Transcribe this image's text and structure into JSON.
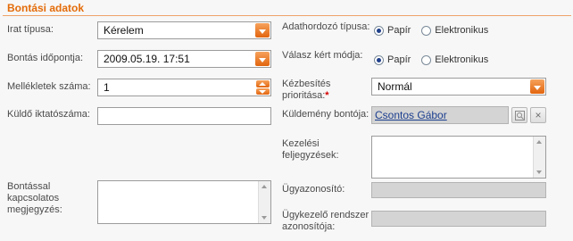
{
  "section": {
    "title": "Bontási adatok"
  },
  "left": {
    "irat_tipusa": {
      "label": "Irat típusa:",
      "value": "Kérelem"
    },
    "bontas_idopontja": {
      "label": "Bontás időpontja:",
      "value": "2009.05.19. 17:51"
    },
    "mellekletek_szama": {
      "label": "Mellékletek száma:",
      "value": "1"
    },
    "kuldo_iktatoszama": {
      "label": "Küldő iktatószáma:",
      "value": ""
    },
    "megjegyzes": {
      "label_line1": "Bontással",
      "label_line2": "kapcsolatos",
      "label_line3": "megjegyzés:",
      "value": ""
    }
  },
  "right": {
    "adathordozo": {
      "label": "Adathordozó típusa:",
      "options": [
        "Papír",
        "Elektronikus"
      ],
      "selected": "Papír"
    },
    "valasz_modja": {
      "label": "Válasz kért módja:",
      "options": [
        "Papír",
        "Elektronikus"
      ],
      "selected": "Papír"
    },
    "kezbesites": {
      "label_line1": "Kézbesítés",
      "label_line2": "prioritása:",
      "required_mark": "*",
      "value": "Normál"
    },
    "kuldemeny_bontoja": {
      "label": "Küldemény bontója:",
      "value": "Csontos Gábor",
      "lookup_icon": "magnifier-icon",
      "clear_icon": "close-icon"
    },
    "kezelesi": {
      "label_line1": "Kezelési",
      "label_line2": "feljegyzések:",
      "value": ""
    },
    "ugyazonosito": {
      "label": "Ügyazonosító:",
      "value": ""
    },
    "ugykezelo": {
      "label_line1": "Ügykezelő rendszer",
      "label_line2": "azonosítója:",
      "value": ""
    }
  },
  "colors": {
    "accent": "#e46c0a",
    "dropdown_button": "#ee8a3a",
    "readonly_bg": "#d4d4d4",
    "link": "#1b3e8f"
  }
}
